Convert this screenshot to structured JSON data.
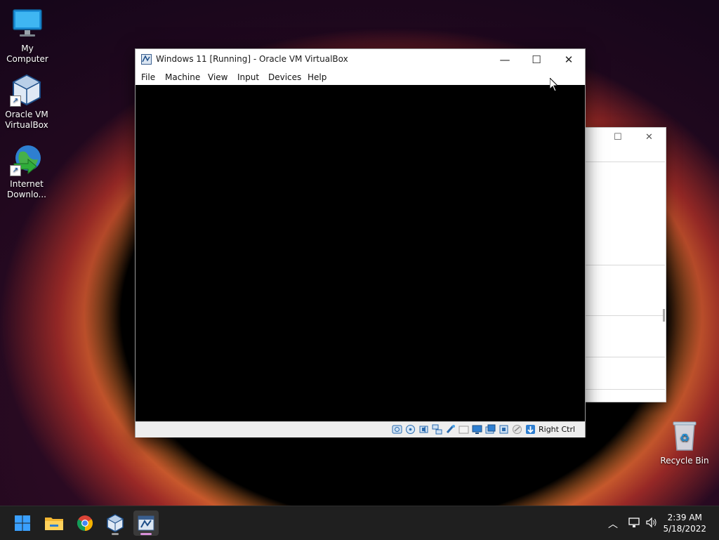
{
  "desktop": {
    "icons": [
      {
        "label": "My Computer"
      },
      {
        "label": "Oracle VM VirtualBox"
      },
      {
        "label": "Internet Downlo..."
      },
      {
        "label": "Recycle Bin"
      }
    ]
  },
  "vm_window": {
    "title": "Windows 11 [Running] - Oracle VM VirtualBox",
    "menu": [
      "File",
      "Machine",
      "View",
      "Input",
      "Devices",
      "Help"
    ],
    "host_key_label": "Right Ctrl"
  },
  "taskbar": {
    "time": "2:39 AM",
    "date": "5/18/2022"
  },
  "colors": {
    "accent_blue": "#0078d4",
    "taskbar_bg": "#1f1f1f",
    "vm_screen": "#000000"
  }
}
